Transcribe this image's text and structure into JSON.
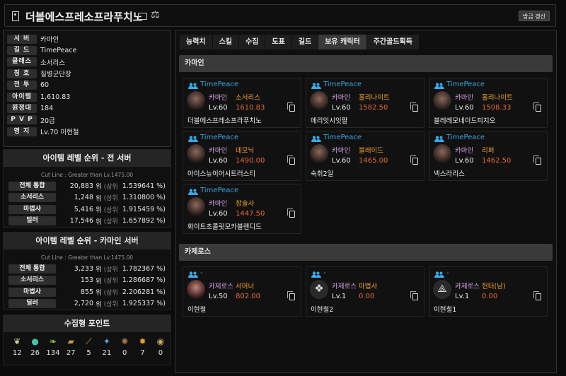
{
  "header": {
    "title": "더블에스프레소프라푸치노",
    "refresh_label": "방금 갱신"
  },
  "info": [
    {
      "label": "서 버",
      "value": "카마인"
    },
    {
      "label": "길 드",
      "value": "TimePeace"
    },
    {
      "label": "클래스",
      "value": "소서리스"
    },
    {
      "label": "칭 호",
      "value": "질병군단장"
    },
    {
      "label": "전 투",
      "value": "60"
    },
    {
      "label": "아이템",
      "value": "1,610.83"
    },
    {
      "label": "원정대",
      "value": "184"
    },
    {
      "label": "P V P",
      "value": "20급"
    },
    {
      "label": "영 지",
      "value": "Lv.70 이현철"
    }
  ],
  "rank_all": {
    "title": "아이템 레벨 순위 - 전 서버",
    "cutline": "Cut Line : Greater than Lv.1475.00",
    "rows": [
      {
        "label": "전체 통합",
        "num": "20,883",
        "wi": "위",
        "sang": "(상위",
        "pct": "1.539641 %)"
      },
      {
        "label": "소서리스",
        "num": "1,248",
        "wi": "위",
        "sang": "(상위",
        "pct": "1.310800 %)"
      },
      {
        "label": "마법사",
        "num": "5,416",
        "wi": "위",
        "sang": "(상위",
        "pct": "1.915459 %)"
      },
      {
        "label": "딜러",
        "num": "17,546",
        "wi": "위",
        "sang": "(상위",
        "pct": "1.657892 %)"
      }
    ]
  },
  "rank_server": {
    "title": "아이템 레벨 순위 - 카마인 서버",
    "cutline": "Cut Line : Greater than Lv.1475.00",
    "rows": [
      {
        "label": "전체 통합",
        "num": "3,233",
        "wi": "위",
        "sang": "(상위",
        "pct": "1.782367 %)"
      },
      {
        "label": "소서리스",
        "num": "153",
        "wi": "위",
        "sang": "(상위",
        "pct": "1.286687 %)"
      },
      {
        "label": "마법사",
        "num": "855",
        "wi": "위",
        "sang": "(상위",
        "pct": "2.206281 %)"
      },
      {
        "label": "딜러",
        "num": "2,720",
        "wi": "위",
        "sang": "(상위",
        "pct": "1.925337 %)"
      }
    ]
  },
  "collection": {
    "title": "수집형 포인트",
    "items": [
      {
        "icon": "mokoko-seed-icon",
        "count": "12"
      },
      {
        "icon": "island-heart-icon",
        "count": "26"
      },
      {
        "icon": "giant-heart-icon",
        "count": "134"
      },
      {
        "icon": "ignea-token-icon",
        "count": "27"
      },
      {
        "icon": "art-icon",
        "count": "5"
      },
      {
        "icon": "world-tree-leaf-icon",
        "count": "21"
      },
      {
        "icon": "ocean-adventure-icon",
        "count": "0"
      },
      {
        "icon": "orpheus-star-icon",
        "count": "7"
      },
      {
        "icon": "sea-bounty-icon",
        "count": "0"
      }
    ]
  },
  "tabs": [
    "능력치",
    "스킬",
    "수집",
    "도표",
    "길드",
    "보유 캐릭터",
    "주간골드획득"
  ],
  "active_tab": 5,
  "sections": [
    {
      "name": "카마인",
      "cards": [
        {
          "guild": "TimePeace",
          "server": "카마인",
          "class": "소서리스",
          "level": "Lv.60",
          "item_level": "1610.83",
          "char": "더블에스프레소프라푸치노"
        },
        {
          "guild": "TimePeace",
          "server": "카마인",
          "class": "홀리나이트",
          "level": "Lv.60",
          "item_level": "1582.50",
          "char": "에리잇시잇팔"
        },
        {
          "guild": "TimePeace",
          "server": "카마인",
          "class": "홀리나이트",
          "level": "Lv.60",
          "item_level": "1508.33",
          "char": "블레레모네이드피지오"
        },
        {
          "guild": "TimePeace",
          "server": "카마인",
          "class": "데모닉",
          "level": "Lv.60",
          "item_level": "1490.00",
          "char": "아이스뉴이어시트러스티"
        },
        {
          "guild": "TimePeace",
          "server": "카마인",
          "class": "블레이드",
          "level": "Lv.60",
          "item_level": "1465.00",
          "char": "숙취2일"
        },
        {
          "guild": "TimePeace",
          "server": "카마인",
          "class": "리퍼",
          "level": "Lv.60",
          "item_level": "1462.50",
          "char": "넥스라리스"
        },
        {
          "guild": "TimePeace",
          "server": "카마인",
          "class": "창술사",
          "level": "Lv.60",
          "item_level": "1447.50",
          "char": "화이트초콜릿모카블렌디드"
        }
      ]
    },
    {
      "name": "카제로스",
      "cards": [
        {
          "guild": "-",
          "server": "카제로스",
          "class": "서머너",
          "level": "Lv.50",
          "item_level": "802.00",
          "char": "이현철"
        },
        {
          "guild": "-",
          "server": "카제로스",
          "class": "마법사",
          "level": "Lv.1",
          "item_level": "0.00",
          "char": "이현철2"
        },
        {
          "guild": "-",
          "server": "카제로스",
          "class": "헌터(남)",
          "level": "Lv.1",
          "item_level": "0.00",
          "char": "이현철1"
        }
      ]
    }
  ]
}
